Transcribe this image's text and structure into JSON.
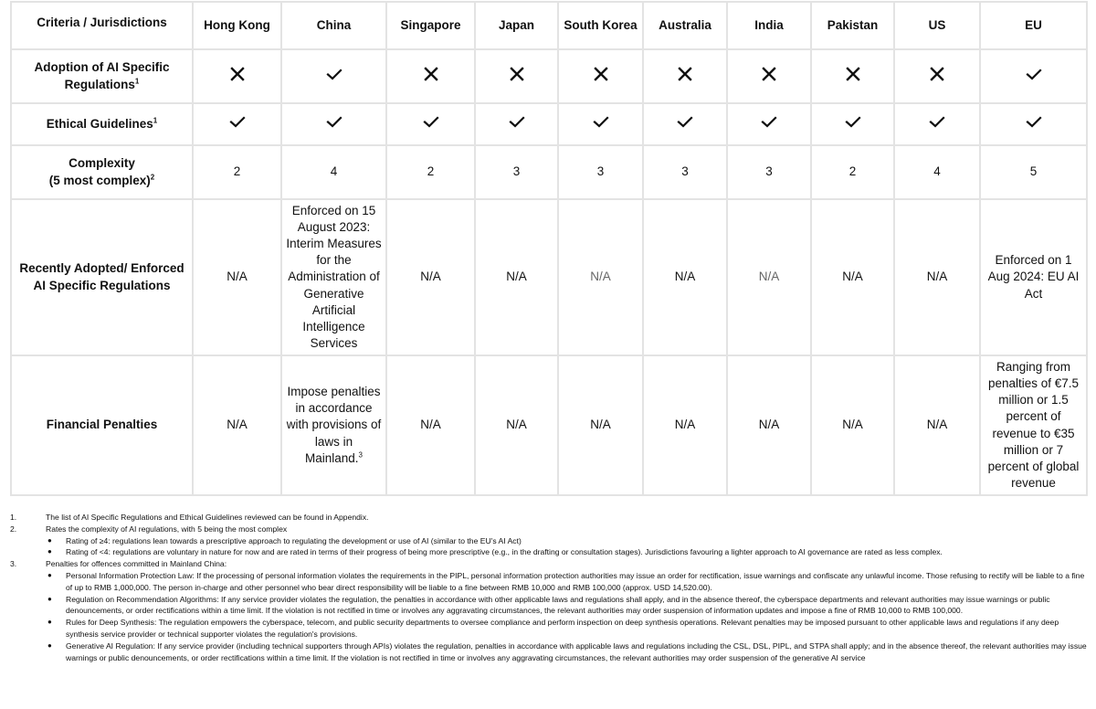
{
  "table": {
    "corner_header": "Criteria / Jurisdictions",
    "jurisdictions": [
      "Hong Kong",
      "China",
      "Singapore",
      "Japan",
      "South Korea",
      "Australia",
      "India",
      "Pakistan",
      "US",
      "EU"
    ],
    "rows": [
      {
        "criterion": "Adoption of AI Specific Regulations",
        "criterion_sup": "1",
        "type": "icon",
        "values": [
          "cross",
          "check",
          "cross",
          "cross",
          "cross",
          "cross",
          "cross",
          "cross",
          "cross",
          "check"
        ]
      },
      {
        "criterion": "Ethical Guidelines",
        "criterion_sup": "1",
        "type": "icon",
        "values": [
          "check",
          "check",
          "check",
          "check",
          "check",
          "check",
          "check",
          "check",
          "check",
          "check"
        ]
      },
      {
        "criterion": "Complexity",
        "criterion_line2": "(5 most complex)",
        "criterion_sup": "2",
        "type": "text",
        "values": [
          "2",
          "4",
          "2",
          "3",
          "3",
          "3",
          "3",
          "2",
          "4",
          "5"
        ]
      },
      {
        "criterion": "Recently Adopted/ Enforced AI Specific Regulations",
        "type": "text",
        "values": [
          "N/A",
          "Enforced on 15 August 2023: Interim Measures for the Administration of Generative Artificial Intelligence Services",
          "N/A",
          "N/A",
          "N/A",
          "N/A",
          "N/A",
          "N/A",
          "N/A",
          "Enforced on 1 Aug 2024: EU AI Act"
        ],
        "muted": [
          false,
          false,
          false,
          false,
          true,
          false,
          true,
          false,
          false,
          false
        ]
      },
      {
        "criterion": "Financial Penalties",
        "type": "text",
        "values": [
          "N/A",
          "Impose penalties in accordance with provisions of laws in Mainland.",
          "N/A",
          "N/A",
          "N/A",
          "N/A",
          "N/A",
          "N/A",
          "N/A",
          "Ranging from penalties of €7.5 million or 1.5 percent of revenue to €35 million or 7 percent of global revenue"
        ],
        "sups": [
          "",
          "3",
          "",
          "",
          "",
          "",
          "",
          "",
          "",
          ""
        ]
      }
    ]
  },
  "icons": {
    "check": "check-icon",
    "cross": "cross-icon"
  },
  "footnotes": [
    {
      "num": "1.",
      "text": "The list of AI Specific Regulations and Ethical Guidelines reviewed can be found in Appendix.",
      "bullets": []
    },
    {
      "num": "2.",
      "text": "Rates the complexity of AI regulations, with 5 being the most complex",
      "bullets": [
        "Rating of ≥4: regulations lean towards a prescriptive approach to regulating the development or use of AI (similar to the EU's AI Act)",
        "Rating of <4: regulations are voluntary in nature for now and are rated in terms of their progress of being more prescriptive (e.g., in the drafting or consultation stages). Jurisdictions favouring a lighter approach to AI governance are rated as less complex."
      ]
    },
    {
      "num": "3.",
      "text": "Penalties for offences committed in Mainland China:",
      "bullets": [
        "Personal Information Protection Law: If the processing of personal information violates the requirements in the PIPL, personal information protection authorities may issue an order for rectification, issue warnings and confiscate any unlawful income. Those refusing to rectify will be liable to a fine of up to RMB 1,000,000. The person in-charge and other personnel who bear direct responsibility will be liable to a fine between RMB 10,000 and RMB 100,000 (approx. USD 14,520.00).",
        "Regulation on Recommendation Algorithms: If any service provider violates the regulation, the penalties in accordance with other applicable laws and regulations shall apply, and in the absence thereof, the cyberspace departments and relevant authorities may issue warnings or public denouncements, or order rectifications within a time limit. If the violation is not rectified in time or involves any aggravating circumstances, the relevant authorities may order suspension of information updates and impose a fine of RMB 10,000 to RMB 100,000.",
        "Rules for Deep Synthesis: The regulation empowers the cyberspace, telecom, and public security departments to oversee compliance and perform inspection on deep synthesis operations. Relevant penalties may be imposed pursuant to other applicable laws and regulations if any deep synthesis service provider or technical supporter violates the regulation's provisions.",
        "Generative AI Regulation: If any service provider (including technical supporters through APIs) violates the regulation, penalties in accordance with applicable laws and regulations including the CSL, DSL, PIPL, and STPA shall apply; and in the absence thereof, the relevant authorities may issue warnings or public denouncements, or order rectifications within a time limit. If the violation is not rectified in time or involves any aggravating circumstances, the relevant authorities may order suspension of the generative AI service"
      ]
    }
  ]
}
